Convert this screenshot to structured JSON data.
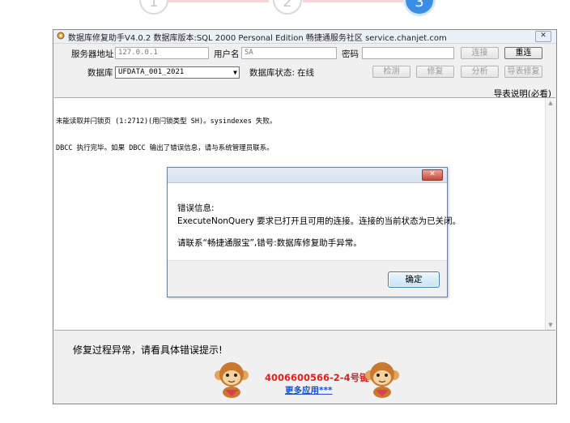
{
  "wizard": {
    "steps": [
      "1",
      "2",
      "3"
    ],
    "active_step": "3"
  },
  "window": {
    "title": "数据库修复助手V4.0.2 数据库版本:SQL 2000 Personal Edition   畅捷通服务社区 service.chanjet.com",
    "close_icon": "close-icon"
  },
  "form": {
    "server_label": "服务器地址",
    "server_value": "127.0.0.1",
    "user_label": "用户名",
    "user_value": "SA",
    "password_label": "密码",
    "password_value": "",
    "db_label": "数据库",
    "db_value": "UFDATA_001_2021",
    "db_status_label": "数据库状态:",
    "db_status_value": "在线"
  },
  "buttons": {
    "connect": "连接",
    "reconnect": "重连",
    "check": "检测",
    "repair": "修复",
    "analyze": "分析",
    "import_repair": "导表修复"
  },
  "help_link": "导表说明(必看)",
  "log": {
    "lines": [
      "未能读取并闩锁页 (1:2712)(用闩锁类型 SH)。sysindexes 失败。",
      "DBCC 执行完毕。如果 DBCC 输出了错误信息，请与系统管理员联系。"
    ]
  },
  "status_message": "修复过程异常，请看具体错误提示!",
  "footer": {
    "phone": "4006600566-2-4号键",
    "more_link": "更多应用***"
  },
  "dialog": {
    "heading": "错误信息:",
    "message": "ExecuteNonQuery 要求已打开且可用的连接。连接的当前状态为已关闭。",
    "contact": "请联系“畅捷通服宝”,错号:数据库修复助手异常。",
    "ok_label": "确定"
  },
  "colors": {
    "accent": "#3a8ee6",
    "phone_red": "#e02020",
    "link_blue": "#1a4fd4"
  }
}
